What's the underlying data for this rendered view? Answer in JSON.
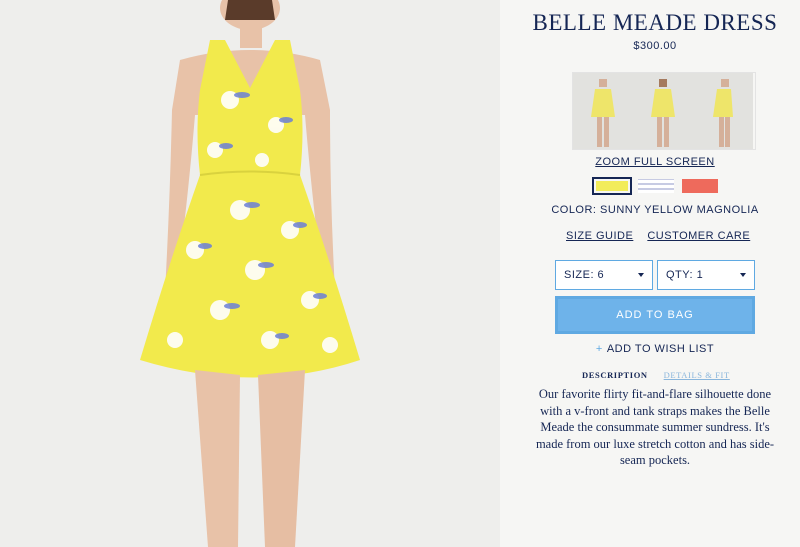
{
  "product": {
    "title": "BELLE MEADE DRESS",
    "price": "$300.00",
    "zoom_label": "ZOOM FULL SCREEN",
    "color_label": "COLOR: SUNNY YELLOW MAGNOLIA",
    "size_guide": "SIZE GUIDE",
    "customer_care": "CUSTOMER CARE",
    "size_select": "SIZE: 6",
    "qty_select": "QTY: 1",
    "add_to_bag": "ADD TO BAG",
    "wish_plus": "+",
    "add_to_wish": "ADD TO WISH LIST",
    "tabs": {
      "description": "DESCRIPTION",
      "details": "DETAILS & FIT"
    },
    "description": "Our favorite flirty fit-and-flare silhouette done with a v-front and tank straps makes the Belle Meade the consummate summer sundress. It's made from our luxe stretch cotton and has side-seam pockets."
  },
  "colors": {
    "accent": "#5fa9e2",
    "navy": "#152654",
    "swatch_yellow": "#f2ec5a",
    "swatch_stripe": "#d9dbe8",
    "swatch_coral": "#ee6a5c"
  }
}
